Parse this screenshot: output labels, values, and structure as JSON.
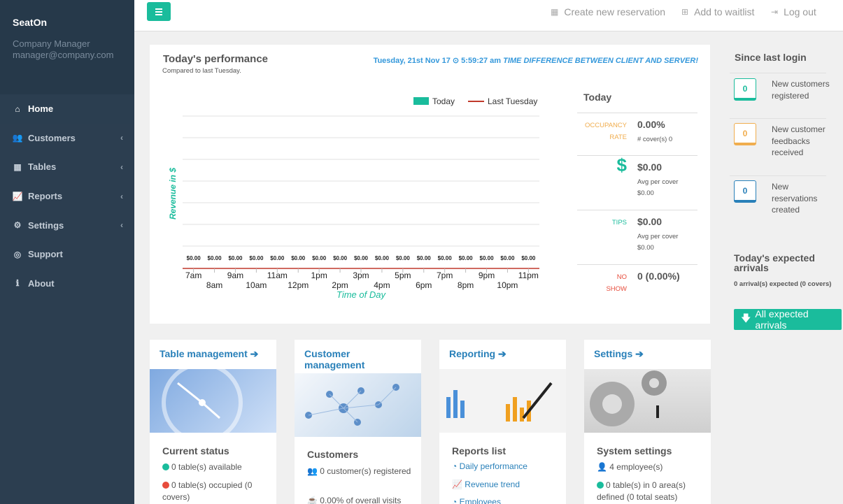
{
  "sidebar": {
    "app_name": "SeatOn",
    "role": "Company Manager",
    "email": "manager@company.com",
    "items": [
      {
        "label": "Home",
        "icon": "home-icon"
      },
      {
        "label": "Customers",
        "icon": "users-icon"
      },
      {
        "label": "Tables",
        "icon": "table-icon"
      },
      {
        "label": "Reports",
        "icon": "line-chart-icon"
      },
      {
        "label": "Settings",
        "icon": "gears-icon"
      },
      {
        "label": "Support",
        "icon": "lifebuoy-icon"
      },
      {
        "label": "About",
        "icon": "info-icon"
      }
    ]
  },
  "topbar": {
    "new_reservation": "Create new reservation",
    "add_waitlist": "Add to waitlist",
    "logout": "Log out"
  },
  "perf": {
    "title": "Today's performance",
    "subtitle": "Compared to last Tuesday.",
    "date": "Tuesday, 21st Nov 17",
    "time": "5:59:27 am",
    "warning": "TIME DIFFERENCE BETWEEN CLIENT AND SERVER!"
  },
  "chart_data": {
    "type": "bar",
    "title": "",
    "xlabel": "Time of Day",
    "ylabel": "Revenue in $",
    "categories": [
      "7am",
      "8am",
      "9am",
      "10am",
      "11am",
      "12pm",
      "1pm",
      "2pm",
      "3pm",
      "4pm",
      "5pm",
      "6pm",
      "7pm",
      "8pm",
      "9pm",
      "10pm",
      "11pm"
    ],
    "series": [
      {
        "name": "Today",
        "values": [
          0,
          0,
          0,
          0,
          0,
          0,
          0,
          0,
          0,
          0,
          0,
          0,
          0,
          0,
          0,
          0,
          0
        ]
      },
      {
        "name": "Last Tuesday",
        "values": [
          0,
          0,
          0,
          0,
          0,
          0,
          0,
          0,
          0,
          0,
          0,
          0,
          0,
          0,
          0,
          0,
          0
        ]
      }
    ],
    "data_labels": [
      "$0.00",
      "$0.00",
      "$0.00",
      "$0.00",
      "$0.00",
      "$0.00",
      "$0.00",
      "$0.00",
      "$0.00",
      "$0.00",
      "$0.00",
      "$0.00",
      "$0.00",
      "$0.00",
      "$0.00",
      "$0.00",
      "$0.00"
    ],
    "legend": "top-right",
    "grid": true,
    "colors": {
      "Today": "#1abc9c",
      "Last Tuesday": "#c0392b"
    }
  },
  "today": {
    "title": "Today",
    "occ_label": "OCCUPANCY RATE",
    "occ_value": "0.00%",
    "occ_sub": "# cover(s) 0",
    "rev_icon": "$",
    "rev_value": "$0.00",
    "rev_sub": "Avg per cover $0.00",
    "tips_label": "TIPS",
    "tips_value": "$0.00",
    "tips_sub": "Avg per cover $0.00",
    "noshow_label": "NO SHOW",
    "noshow_value": "0 (0.00%)"
  },
  "modules": {
    "table": {
      "title": "Table management",
      "sub": "Current status",
      "l1": "0 table(s) available",
      "l2": "0 table(s) occupied (0 covers)"
    },
    "customer": {
      "title": "Customer management",
      "sub": "Customers",
      "l1": "0 customer(s) registered",
      "l2": "0.00% of overall visits"
    },
    "reporting": {
      "title": "Reporting",
      "sub": "Reports list",
      "l1": "Daily performance",
      "l2": "Revenue trend",
      "l3": "Employees"
    },
    "settings": {
      "title": "Settings",
      "sub": "System settings",
      "l1": "4 employee(s)",
      "l2": "0 table(s) in 0 area(s) defined (0 total seats)"
    }
  },
  "right": {
    "title": "Since last login",
    "items": [
      {
        "count": "0",
        "label": "New customers registered",
        "color": "#1abc9c"
      },
      {
        "count": "0",
        "label": "New customer feedbacks received",
        "color": "#f0ad4e"
      },
      {
        "count": "0",
        "label": "New reservations created",
        "color": "#2980b9"
      }
    ],
    "arrivals_title": "Today's expected arrivals",
    "arrivals_sub": "0 arrival(s) expected (0 covers)",
    "arrivals_button": "All expected arrivals"
  }
}
